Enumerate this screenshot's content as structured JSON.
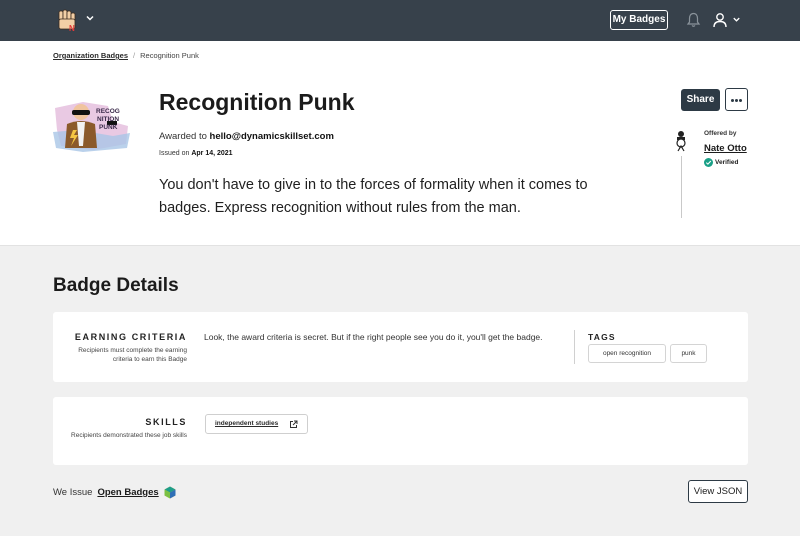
{
  "nav": {
    "my_badges_label": "My Badges",
    "icons": [
      "fist-logo-icon",
      "chevron-down-icon",
      "bell-icon",
      "user-icon",
      "chevron-down-icon"
    ]
  },
  "breadcrumb": {
    "parent": "Organization Badges",
    "current": "Recognition Punk"
  },
  "badge": {
    "image_text": [
      "RECOG",
      "NITION",
      "PUNK"
    ],
    "title": "Recognition Punk",
    "awarded_prefix": "Awarded to ",
    "recipient": "hello@dynamicskillset.com",
    "issued_prefix": "Issued on ",
    "issued_date": "Apr 14, 2021",
    "description": "You don't have to give in to the forces of formality when it comes to badges. Express recognition without rules from the man."
  },
  "actions": {
    "share_label": "Share",
    "more_label": "More options"
  },
  "issuer": {
    "offered_by_label": "Offered by",
    "name": "Nate Otto",
    "verified_label": "Verified"
  },
  "details": {
    "heading": "Badge Details",
    "criteria": {
      "label": "EARNING CRITERIA",
      "sub": "Recipients must complete the earning criteria to earn this Badge",
      "text": "Look, the award criteria is secret. But if the right people see you do it, you'll get the badge."
    },
    "tags": {
      "label": "TAGS",
      "items": [
        "open recognition",
        "punk"
      ]
    },
    "skills": {
      "label": "SKILLS",
      "sub": "Recipients demonstrated these job skills",
      "items": [
        "independent studies"
      ]
    }
  },
  "footer": {
    "we_issue": "We Issue",
    "open_badges": "Open Badges",
    "view_json_label": "View JSON"
  },
  "colors": {
    "nav_bg": "#37414b",
    "primary_button": "#2d3a45",
    "verified_green": "#1aa087",
    "page_bg": "#f0f0f0"
  }
}
